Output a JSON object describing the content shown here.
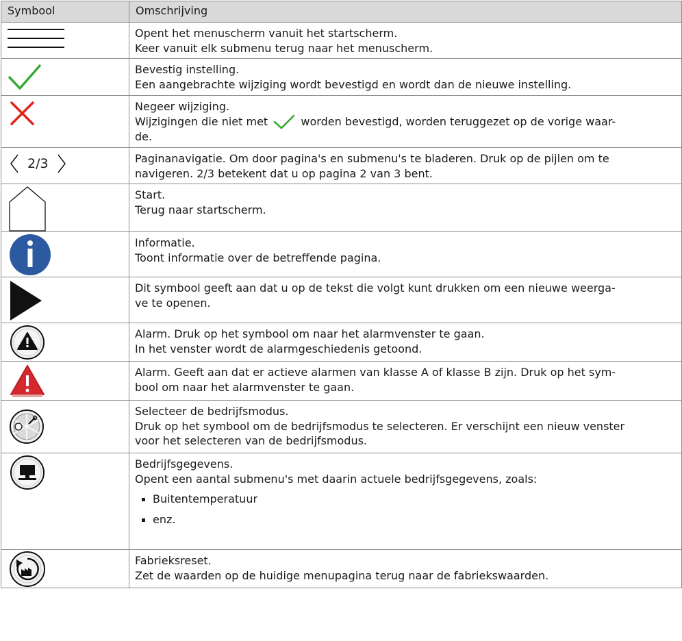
{
  "table": {
    "headers": [
      "Symbool",
      "Omschrijving"
    ],
    "rows": [
      {
        "icon": "menu-icon",
        "lines": [
          "Opent het menuscherm vanuit het startscherm.",
          "Keer vanuit elk submenu terug naar het menuscherm."
        ]
      },
      {
        "icon": "checkmark-icon",
        "lines": [
          "Bevestig instelling.",
          "Een aangebrachte wijziging wordt bevestigd en wordt dan de nieuwe instelling."
        ]
      },
      {
        "icon": "cross-icon",
        "lines": [
          "Negeer wijziging.",
          "Wijzigingen die niet met",
          "worden bevestigd, worden teruggezet op de vorige waar-",
          "de."
        ]
      },
      {
        "icon": "page-navigation-icon",
        "page_label": "2/3",
        "lines": [
          "Paginanavigatie. Om door pagina's en submenu's te bladeren. Druk op de pijlen om te",
          "navigeren. 2/3 betekent dat u op pagina 2 van 3 bent."
        ]
      },
      {
        "icon": "home-icon",
        "lines": [
          "Start.",
          "Terug naar startscherm."
        ]
      },
      {
        "icon": "info-icon",
        "lines": [
          "Informatie.",
          "Toont informatie over de betreffende pagina."
        ]
      },
      {
        "icon": "play-arrow-icon",
        "lines": [
          "Dit symbool geeft aan dat u op de tekst die volgt kunt drukken om een nieuwe weerga-",
          "ve te openen."
        ]
      },
      {
        "icon": "alarm-button-icon",
        "lines": [
          "Alarm. Druk op het symbool om naar het alarmvenster te gaan.",
          "In het venster wordt de alarmgeschiedenis getoond."
        ]
      },
      {
        "icon": "active-alarm-icon",
        "lines": [
          "Alarm. Geeft aan dat er actieve alarmen van klasse A of klasse B zijn. Druk op het sym-",
          "bool om naar het alarmvenster te gaan."
        ]
      },
      {
        "icon": "operating-mode-icon",
        "lines": [
          "Selecteer de bedrijfsmodus.",
          "Druk op het symbool om de bedrijfsmodus te selecteren. Er verschijnt een nieuw venster",
          "voor het selecteren van de bedrijfsmodus."
        ]
      },
      {
        "icon": "operating-data-icon",
        "lines": [
          "Bedrijfsgegevens.",
          "Opent een aantal submenu's met daarin actuele bedrijfsgegevens, zoals:"
        ],
        "bullets": [
          "Buitentemperatuur",
          "enz."
        ]
      },
      {
        "icon": "factory-reset-icon",
        "lines": [
          "Fabrieksreset.",
          "Zet de waarden op de huidige menupagina terug naar de fabriekswaarden."
        ]
      }
    ]
  },
  "colors": {
    "check": "#3aa935",
    "cross": "#e2231a",
    "info": "#2c5aa0",
    "alarm": "#d7282f"
  }
}
